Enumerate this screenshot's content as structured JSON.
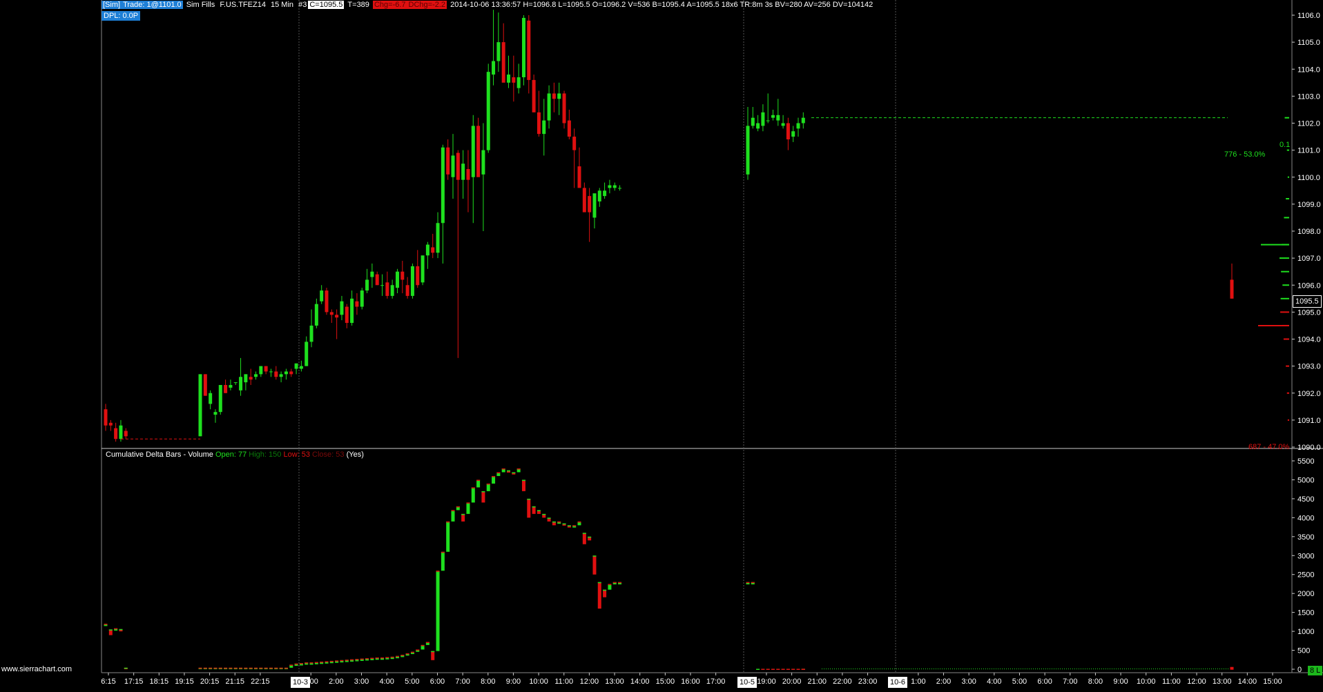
{
  "header": {
    "account": "[Sim]",
    "trade": "Trade: 1@1101.0",
    "fills": "Sim Fills",
    "symbol": "F.US.TFEZ14",
    "interval": "15 Min",
    "chart_no": "#3",
    "close": "C=1095.5",
    "ticks": "T=389",
    "chg": "Chg=-6.7",
    "dchg": "DChg=-2.2",
    "details": "2014-10-06 13:36:57 H=1096.8 L=1095.5 O=1096.2 V=536 B=1095.4 A=1095.5 18x6 TR:8m 3s BV=280 AV=256 DV=104142",
    "dpl": "DPL: 0.0P"
  },
  "price_axis": {
    "labels": [
      "1106.0",
      "1105.0",
      "1104.0",
      "1103.0",
      "1102.0",
      "1101.0",
      "1100.0",
      "1099.0",
      "1098.0",
      "1097.0",
      "1096.0",
      "1095.0",
      "1094.0",
      "1093.0",
      "1092.0",
      "1091.0",
      "1090.0"
    ],
    "current_price": "1095.5",
    "current_value": 1095.5,
    "top_price": 1106.0,
    "bottom_price": 1090.0
  },
  "volume_profile": {
    "upper_label_1": "0.1",
    "upper_label_2": "776 - 53.0%",
    "lower_label": "687 - 47.0%"
  },
  "subgraph": {
    "title": "Cumulative Delta Bars - Volume",
    "open": "Open: 77",
    "high": "High: 150",
    "low": "Low: 53",
    "close": "Close: 53",
    "flag": "(Yes)",
    "axis_labels": [
      "5500",
      "5000",
      "4500",
      "4000",
      "3500",
      "3000",
      "2500",
      "2000",
      "1500",
      "1000",
      "500",
      "0"
    ]
  },
  "time_axis": {
    "labels": [
      "6:15",
      "17:15",
      "18:15",
      "19:15",
      "20:15",
      "21:15",
      "22:15",
      "10-3",
      "1:00",
      "2:00",
      "3:00",
      "4:00",
      "5:00",
      "6:00",
      "7:00",
      "8:00",
      "9:00",
      "10:00",
      "11:00",
      "12:00",
      "13:00",
      "14:00",
      "15:00",
      "16:00",
      "17:00",
      "10-5",
      "19:00",
      "20:00",
      "21:00",
      "22:00",
      "23:00",
      "10-6",
      "1:00",
      "2:00",
      "3:00",
      "4:00",
      "5:00",
      "6:00",
      "7:00",
      "8:00",
      "9:00",
      "10:00",
      "11:00",
      "12:00",
      "13:00",
      "14:00",
      "15:00"
    ],
    "date_tags": [
      "10-3",
      "10-5",
      "10-6"
    ]
  },
  "watermark": "www.sierrachart.com",
  "badge": "8 L",
  "colors": {
    "up": "#1ee01e",
    "down": "#e01010",
    "background": "#000000",
    "grid": "#555555"
  },
  "chart_data": {
    "type": "candlestick",
    "title": "",
    "price_series": {
      "x_labels": [
        "6:15",
        "17:15",
        "18:15",
        "19:15",
        "20:15",
        "21:15",
        "22:15",
        "1:00",
        "2:00",
        "3:00",
        "4:00",
        "5:00",
        "6:00",
        "7:00",
        "8:00",
        "9:00",
        "10:00",
        "11:00",
        "12:00",
        "13:00",
        "14:00",
        "15:00",
        "16:00",
        "17:00",
        "19:00",
        "20:00",
        "21:00"
      ],
      "ohlc": [
        [
          1091.4,
          1091.6,
          1090.6,
          1090.8
        ],
        [
          1090.9,
          1091.0,
          1090.6,
          1090.8
        ],
        [
          1090.7,
          1090.9,
          1090.2,
          1090.3
        ],
        [
          1090.3,
          1091.0,
          1090.2,
          1090.8
        ],
        [
          1090.6,
          1090.7,
          1090.3,
          1090.4
        ],
        [
          1090.4,
          1092.7,
          1090.4,
          1092.7
        ],
        [
          1092.7,
          1092.7,
          1091.9,
          1091.9
        ],
        [
          1091.6,
          1092.1,
          1091.4,
          1092.0
        ],
        [
          1091.2,
          1091.4,
          1090.9,
          1091.3
        ],
        [
          1091.3,
          1092.3,
          1091.2,
          1092.3
        ],
        [
          1092.3,
          1092.5,
          1092.0,
          1092.0
        ],
        [
          1092.2,
          1092.5,
          1092.1,
          1092.3
        ],
        [
          1092.4,
          1092.4,
          1092.3,
          1092.4
        ],
        [
          1092.1,
          1093.3,
          1091.9,
          1092.6
        ],
        [
          1092.4,
          1092.7,
          1092.1,
          1092.7
        ],
        [
          1092.6,
          1092.9,
          1092.3,
          1092.5
        ],
        [
          1092.6,
          1092.8,
          1092.5,
          1092.7
        ],
        [
          1092.7,
          1093.0,
          1092.6,
          1093.0
        ],
        [
          1093.0,
          1093.0,
          1092.7,
          1092.8
        ],
        [
          1092.8,
          1092.9,
          1092.6,
          1092.8
        ],
        [
          1092.8,
          1093.0,
          1092.5,
          1092.6
        ],
        [
          1092.6,
          1092.8,
          1092.4,
          1092.7
        ],
        [
          1092.7,
          1092.9,
          1092.5,
          1092.8
        ],
        [
          1092.8,
          1092.9,
          1092.6,
          1092.7
        ],
        [
          1092.9,
          1093.1,
          1092.7,
          1093.1
        ],
        [
          1092.9,
          1093.2,
          1092.8,
          1093.0
        ],
        [
          1093.0,
          1094.1,
          1093.0,
          1093.9
        ],
        [
          1093.9,
          1095.1,
          1093.7,
          1094.5
        ],
        [
          1094.5,
          1095.5,
          1094.4,
          1095.3
        ],
        [
          1095.4,
          1096.0,
          1095.3,
          1095.8
        ],
        [
          1095.8,
          1095.9,
          1094.9,
          1095.0
        ],
        [
          1095.0,
          1095.1,
          1094.6,
          1094.9
        ],
        [
          1094.9,
          1095.1,
          1094.0,
          1094.8
        ],
        [
          1094.9,
          1095.6,
          1094.7,
          1095.4
        ],
        [
          1095.2,
          1095.3,
          1094.4,
          1094.6
        ],
        [
          1094.6,
          1095.8,
          1094.5,
          1095.5
        ],
        [
          1095.4,
          1095.7,
          1094.9,
          1095.2
        ],
        [
          1095.2,
          1095.9,
          1095.1,
          1095.8
        ],
        [
          1095.8,
          1096.6,
          1095.7,
          1096.2
        ],
        [
          1096.3,
          1096.8,
          1095.9,
          1096.5
        ],
        [
          1096.4,
          1096.5,
          1096.0,
          1096.0
        ],
        [
          1096.0,
          1096.4,
          1095.6,
          1096.0
        ],
        [
          1096.1,
          1096.5,
          1095.5,
          1095.6
        ],
        [
          1095.6,
          1096.2,
          1095.5,
          1096.0
        ],
        [
          1095.9,
          1096.6,
          1095.7,
          1096.5
        ],
        [
          1096.5,
          1096.9,
          1095.7,
          1096.2
        ],
        [
          1096.0,
          1096.3,
          1095.5,
          1095.6
        ],
        [
          1095.6,
          1096.8,
          1095.5,
          1096.7
        ],
        [
          1096.7,
          1097.3,
          1095.9,
          1096.0
        ],
        [
          1096.1,
          1097.0,
          1096.0,
          1097.1
        ],
        [
          1097.1,
          1097.6,
          1096.6,
          1097.5
        ],
        [
          1097.4,
          1097.9,
          1097.0,
          1097.2
        ],
        [
          1097.2,
          1098.7,
          1097.0,
          1098.3
        ],
        [
          1098.3,
          1101.2,
          1096.8,
          1101.1
        ],
        [
          1101.1,
          1101.4,
          1099.9,
          1100.1
        ],
        [
          1100.0,
          1101.6,
          1099.2,
          1100.8
        ],
        [
          1100.9,
          1101.0,
          1093.3,
          1099.9
        ],
        [
          1099.9,
          1101.0,
          1099.2,
          1100.5
        ],
        [
          1100.3,
          1101.0,
          1098.7,
          1099.9
        ],
        [
          1100.0,
          1102.3,
          1098.3,
          1101.9
        ],
        [
          1101.9,
          1102.2,
          1100.2,
          1100.0
        ],
        [
          1100.1,
          1102.0,
          1098.0,
          1101.0
        ],
        [
          1101.0,
          1104.2,
          1100.9,
          1103.9
        ],
        [
          1103.8,
          1106.2,
          1103.4,
          1104.3
        ],
        [
          1104.3,
          1106.1,
          1103.9,
          1105.0
        ],
        [
          1105.0,
          1105.7,
          1104.0,
          1103.5
        ],
        [
          1103.5,
          1104.5,
          1103.3,
          1103.8
        ],
        [
          1103.7,
          1104.5,
          1102.8,
          1103.5
        ],
        [
          1103.3,
          1104.2,
          1103.1,
          1103.7
        ],
        [
          1103.7,
          1106.0,
          1103.4,
          1105.9
        ],
        [
          1105.8,
          1106.0,
          1103.1,
          1103.6
        ],
        [
          1103.6,
          1103.8,
          1102.5,
          1102.4
        ],
        [
          1102.4,
          1103.2,
          1101.5,
          1101.6
        ],
        [
          1101.6,
          1102.9,
          1100.8,
          1102.1
        ],
        [
          1102.1,
          1103.4,
          1101.8,
          1103.1
        ],
        [
          1103.1,
          1103.5,
          1102.4,
          1102.9
        ],
        [
          1102.9,
          1103.5,
          1102.3,
          1103.1
        ],
        [
          1103.1,
          1103.2,
          1101.8,
          1102.0
        ],
        [
          1102.1,
          1102.5,
          1101.4,
          1101.5
        ],
        [
          1101.5,
          1101.8,
          1099.6,
          1101.0
        ],
        [
          1100.4,
          1101.1,
          1099.7,
          1099.6
        ],
        [
          1099.6,
          1099.8,
          1098.8,
          1098.7
        ],
        [
          1099.3,
          1099.6,
          1097.6,
          1098.7
        ],
        [
          1098.5,
          1099.3,
          1098.1,
          1099.4
        ],
        [
          1099.1,
          1099.6,
          1098.9,
          1099.5
        ],
        [
          1099.3,
          1099.8,
          1099.2,
          1099.5
        ],
        [
          1099.6,
          1099.9,
          1099.4,
          1099.7
        ],
        [
          1099.6,
          1099.8,
          1099.5,
          1099.7
        ],
        [
          1099.6,
          1099.7,
          1099.5,
          1099.6
        ],
        [
          1100.1,
          1102.6,
          1099.9,
          1101.9
        ],
        [
          1101.9,
          1102.6,
          1101.8,
          1102.2
        ],
        [
          1101.8,
          1102.3,
          1101.7,
          1102.0
        ],
        [
          1101.9,
          1102.7,
          1101.7,
          1102.4
        ],
        [
          1102.1,
          1103.1,
          1102.0,
          1102.1
        ],
        [
          1102.2,
          1102.5,
          1102.1,
          1102.3
        ],
        [
          1102.1,
          1102.9,
          1101.9,
          1102.3
        ],
        [
          1101.9,
          1102.3,
          1101.8,
          1102.0
        ],
        [
          1102.0,
          1102.2,
          1101.0,
          1101.4
        ],
        [
          1101.5,
          1101.9,
          1101.3,
          1101.7
        ],
        [
          1101.8,
          1102.2,
          1101.5,
          1102.0
        ],
        [
          1102.0,
          1102.4,
          1101.8,
          1102.2
        ]
      ],
      "last_ohlc": [
        1096.2,
        1096.8,
        1095.5,
        1095.5
      ],
      "ylim": [
        1090.0,
        1106.0
      ]
    },
    "cumulative_delta": {
      "values": [
        1200,
        1050,
        1080,
        1060,
        40,
        40,
        40,
        40,
        40,
        40,
        40,
        40,
        40,
        40,
        40,
        40,
        40,
        40,
        40,
        40,
        40,
        40,
        40,
        120,
        150,
        160,
        180,
        180,
        190,
        200,
        210,
        220,
        230,
        240,
        250,
        260,
        270,
        280,
        290,
        300,
        310,
        310,
        320,
        330,
        350,
        380,
        420,
        460,
        520,
        640,
        720,
        480,
        2600,
        3100,
        3900,
        4200,
        4300,
        4100,
        4400,
        4800,
        5000,
        4700,
        4900,
        5100,
        5200,
        5300,
        5250,
        5200,
        5300,
        5000,
        4500,
        4300,
        4200,
        4100,
        4000,
        3900,
        3900,
        3850,
        3800,
        3800,
        3900,
        3600,
        3500,
        3000,
        2300,
        2100,
        2250,
        2300,
        2300,
        2300,
        2300,
        10,
        10,
        10,
        10,
        10,
        10,
        10,
        10,
        10,
        10,
        10,
        10
      ],
      "ylim": [
        0,
        5500
      ]
    },
    "volume_profile": [
      {
        "price": 1102.2,
        "volume": 120
      },
      {
        "price": 1101.0,
        "volume": 60
      },
      {
        "price": 1100.0,
        "volume": 40
      },
      {
        "price": 1099.2,
        "volume": 90
      },
      {
        "price": 1098.5,
        "volume": 140
      },
      {
        "price": 1097.5,
        "volume": 200
      },
      {
        "price": 1097.0,
        "volume": 260
      },
      {
        "price": 1096.5,
        "volume": 220
      },
      {
        "price": 1096.0,
        "volume": 180
      },
      {
        "price": 1095.5,
        "volume": 230
      },
      {
        "price": 1095.0,
        "volume": 240
      },
      {
        "price": 1094.5,
        "volume": 190
      },
      {
        "price": 1094.0,
        "volume": 150
      },
      {
        "price": 1093.0,
        "volume": 90
      },
      {
        "price": 1092.0,
        "volume": 60
      },
      {
        "price": 1091.0,
        "volume": 40
      }
    ],
    "reference_lines": {
      "green_dashed_price": 1102.2,
      "red_dashed_price": 1090.3
    }
  }
}
